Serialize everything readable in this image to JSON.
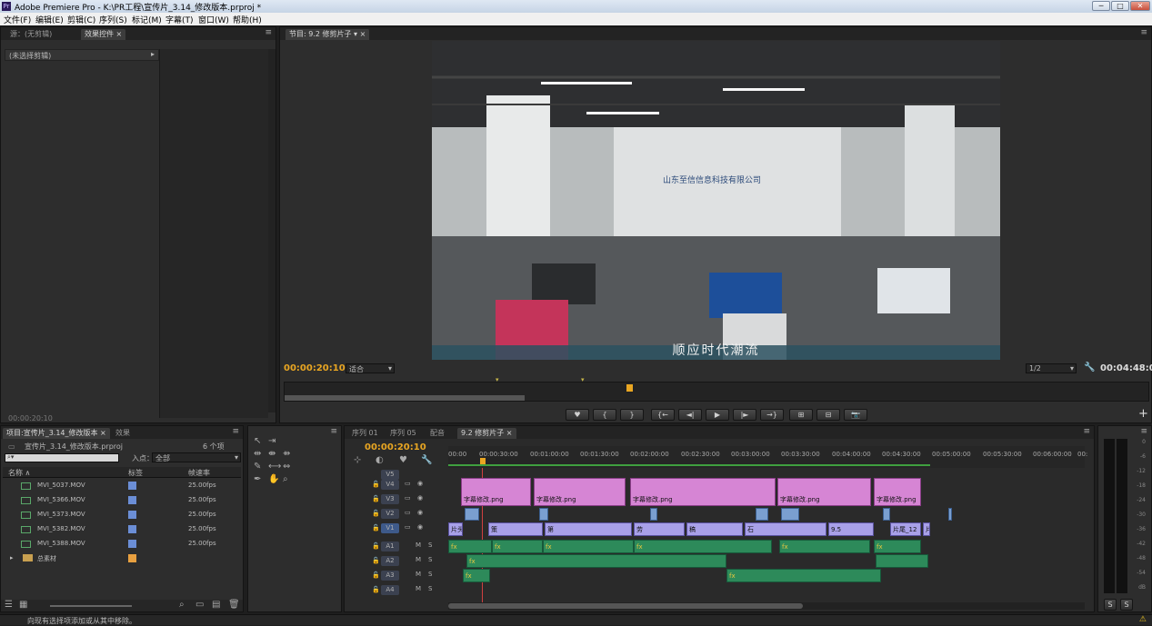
{
  "titlebar": {
    "title": "Adobe Premiere Pro - K:\\PR工程\\宣传片_3.14_修改版本.prproj *",
    "logo": "Pr",
    "minimize": "─",
    "maximize": "□",
    "close": "✕"
  },
  "menu": [
    "文件(F)",
    "编辑(E)",
    "剪辑(C)",
    "序列(S)",
    "标记(M)",
    "字幕(T)",
    "窗口(W)",
    "帮助(H)"
  ],
  "source_panel": {
    "tabs": [
      "源：(无剪辑)",
      "效果控件 ×"
    ],
    "no_clip": "(未选择剪辑)",
    "timecode": "00:00:20:10"
  },
  "program_monitor": {
    "tab": "节目: 9.2 修剪片子 ▾ ×",
    "caption": "顺应时代潮流",
    "company_sign": "山东至信信息科技有限公司",
    "timecode": "00:00:20:10",
    "fit": "适合",
    "quality": "1/2",
    "duration": "00:04:48:03",
    "transport": [
      "♥",
      "{",
      "}",
      "{←",
      "◄|",
      "▶",
      "|►",
      "→}",
      "⊞",
      "⊟",
      "📷"
    ],
    "add": "+"
  },
  "project_panel": {
    "tabs": [
      "项目:宣传片_3.14_修改版本 ×",
      "效果"
    ],
    "file": "宣传片_3.14_修改版本.prproj",
    "count": "6 个项",
    "in_point_label": "入点：",
    "in_point_value": "全部",
    "search_placeholder": "",
    "columns": [
      "名称 ∧",
      "标签",
      "帧速率"
    ],
    "items": [
      {
        "name": "MVI_5037.MOV",
        "fps": "25.00fps"
      },
      {
        "name": "MVI_5366.MOV",
        "fps": "25.00fps"
      },
      {
        "name": "MVI_5373.MOV",
        "fps": "25.00fps"
      },
      {
        "name": "MVI_5382.MOV",
        "fps": "25.00fps"
      },
      {
        "name": "MVI_5388.MOV",
        "fps": "25.00fps"
      }
    ],
    "bin": {
      "name": "总素材",
      "color": "#e8a040"
    }
  },
  "timeline": {
    "tabs": [
      "序列 01",
      "序列 05",
      "配音",
      "9.2 修剪片子 ×"
    ],
    "timecode": "00:00:20:10",
    "ruler": [
      "00:00",
      "00:00:30:00",
      "00:01:00:00",
      "00:01:30:00",
      "00:02:00:00",
      "00:02:30:00",
      "00:03:00:00",
      "00:03:30:00",
      "00:04:00:00",
      "00:04:30:00",
      "00:05:00:00",
      "00:05:30:00",
      "00:06:00:00",
      "00:"
    ],
    "tracks": [
      {
        "id": "V5",
        "type": "video"
      },
      {
        "id": "V4",
        "type": "video"
      },
      {
        "id": "V3",
        "type": "video"
      },
      {
        "id": "V2",
        "type": "video"
      },
      {
        "id": "V1",
        "type": "video"
      },
      {
        "id": "A1",
        "type": "audio"
      },
      {
        "id": "A2",
        "type": "audio"
      },
      {
        "id": "A3",
        "type": "audio"
      },
      {
        "id": "A4",
        "type": "audio"
      }
    ],
    "v3_clip_label": "字幕修改.png",
    "v1_labels": [
      "片头",
      "策",
      "第",
      "劳",
      "稿",
      "石",
      "9.5",
      "片尾_12",
      "片"
    ],
    "audio_fx": "fx"
  },
  "meter": {
    "scale": [
      "0",
      "-6",
      "-12",
      "-18",
      "-24",
      "-30",
      "-36",
      "-42",
      "-48",
      "-54",
      "dB"
    ],
    "solo": [
      "S",
      "S"
    ]
  },
  "status": "向现有选择项添加或从其中移除。"
}
